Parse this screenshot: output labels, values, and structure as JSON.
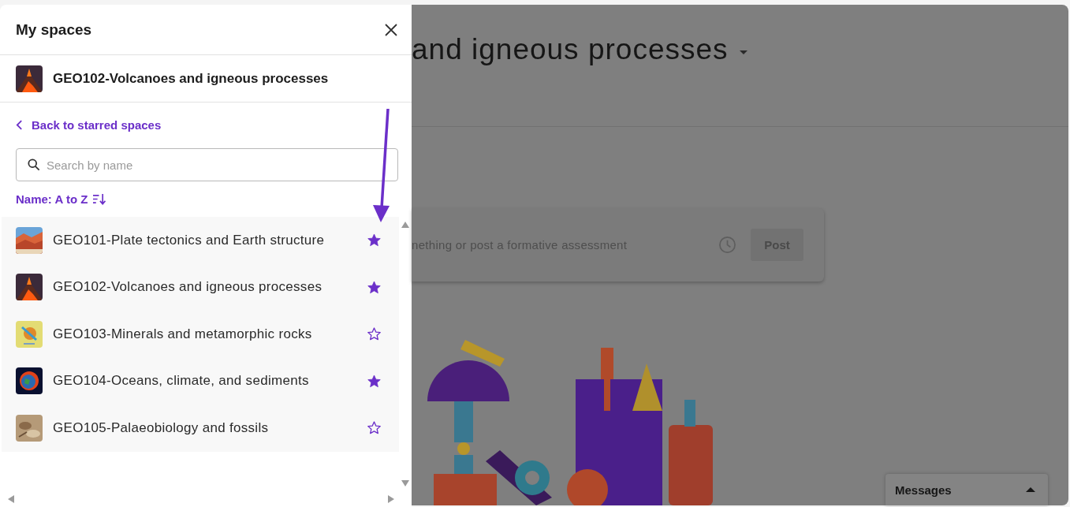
{
  "panel": {
    "title": "My spaces",
    "current_space": {
      "name": "GEO102-Volcanoes and igneous processes"
    },
    "back_link": "Back to starred spaces",
    "search": {
      "placeholder": "Search by name"
    },
    "sort": "Name: A to Z",
    "spaces": [
      {
        "name": "GEO101-Plate tectonics and Earth structure",
        "starred": true
      },
      {
        "name": "GEO102-Volcanoes and igneous processes",
        "starred": true
      },
      {
        "name": "GEO103-Minerals and metamorphic rocks",
        "starred": false
      },
      {
        "name": "GEO104-Oceans, climate, and sediments",
        "starred": true
      },
      {
        "name": "GEO105-Palaeobiology and fossils",
        "starred": false
      }
    ]
  },
  "background": {
    "title": "and igneous processes",
    "composer": {
      "placeholder": "nething or post a formative assessment",
      "button": "Post"
    },
    "messages": "Messages"
  }
}
